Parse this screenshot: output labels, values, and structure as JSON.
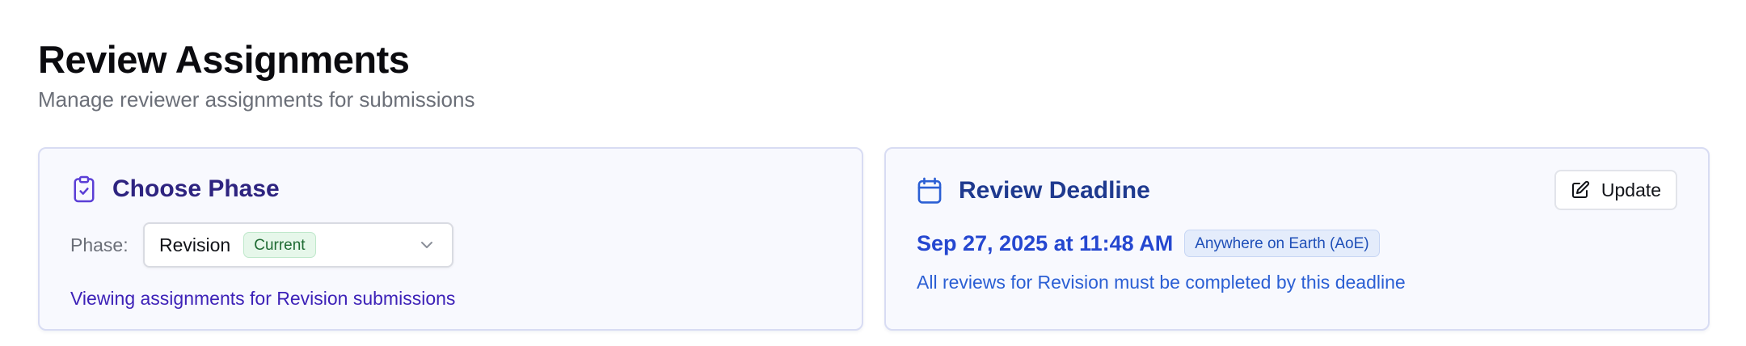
{
  "header": {
    "title": "Review Assignments",
    "subtitle": "Manage reviewer assignments for submissions"
  },
  "phase_card": {
    "icon": "clipboard-check-icon",
    "title": "Choose Phase",
    "phase_label": "Phase:",
    "selected_phase": "Revision",
    "selected_badge": "Current",
    "helper_text": "Viewing assignments for Revision submissions"
  },
  "deadline_card": {
    "icon": "calendar-icon",
    "title": "Review Deadline",
    "update_button": {
      "icon": "edit-icon",
      "label": "Update"
    },
    "deadline": "Sep 27, 2025 at 11:48 AM",
    "timezone_badge": "Anywhere on Earth (AoE)",
    "note": "All reviews for Revision must be completed by this deadline"
  },
  "colors": {
    "phase_accent": "#3d22b8",
    "deadline_accent": "#2547d0",
    "current_badge_bg": "#e6f7ea",
    "aoe_badge_bg": "#e4ecfb",
    "card_bg": "#f8f9fe"
  }
}
